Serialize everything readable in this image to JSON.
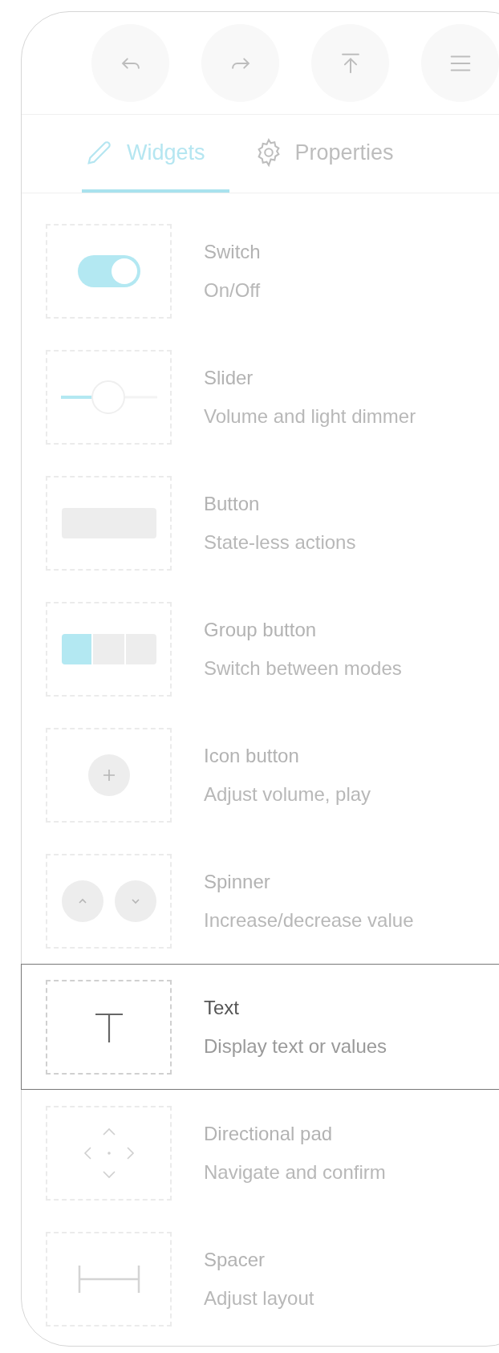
{
  "toolbar": [
    {
      "kind": "undo"
    },
    {
      "kind": "redo"
    },
    {
      "kind": "upload"
    },
    {
      "kind": "menu"
    }
  ],
  "tabs": [
    {
      "kind": "widgets",
      "label": "Widgets",
      "selected": true
    },
    {
      "kind": "properties",
      "label": "Properties",
      "selected": false
    }
  ],
  "widgets": [
    {
      "kind": "switch",
      "title": "Switch",
      "subtitle": "On/Off",
      "selected": false
    },
    {
      "kind": "slider",
      "title": "Slider",
      "subtitle": "Volume and light dimmer",
      "selected": false
    },
    {
      "kind": "button",
      "title": "Button",
      "subtitle": "State-less actions",
      "selected": false
    },
    {
      "kind": "group",
      "title": "Group button",
      "subtitle": "Switch between modes",
      "selected": false
    },
    {
      "kind": "iconbutton",
      "title": "Icon button",
      "subtitle": "Adjust volume, play",
      "selected": false
    },
    {
      "kind": "spinner",
      "title": "Spinner",
      "subtitle": "Increase/decrease value",
      "selected": false
    },
    {
      "kind": "text",
      "title": "Text",
      "subtitle": "Display text or values",
      "selected": true
    },
    {
      "kind": "dpad",
      "title": "Directional pad",
      "subtitle": "Navigate and confirm",
      "selected": false
    },
    {
      "kind": "spacer",
      "title": "Spacer",
      "subtitle": "Adjust layout",
      "selected": false
    }
  ]
}
